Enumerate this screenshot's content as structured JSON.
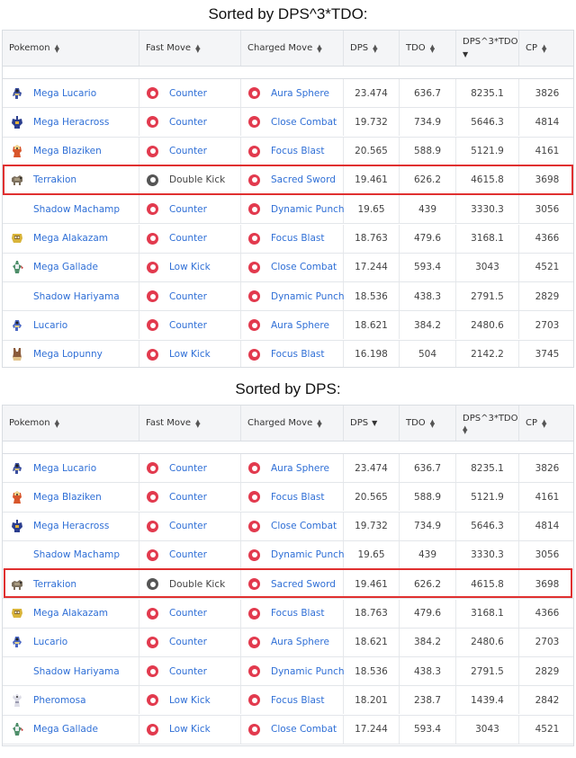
{
  "sections": [
    {
      "title": "Sorted by DPS^3*TDO:",
      "headers": {
        "pokemon": "Pokemon",
        "fast_move": "Fast Move",
        "charged_move": "Charged Move",
        "dps": "DPS",
        "tdo": "TDO",
        "dps3tdo": "DPS^3*TDO",
        "cp": "CP"
      },
      "rows": [
        {
          "pokemon": "Mega Lucario",
          "fast": "Counter",
          "charged": "Aura Sphere",
          "dps": "23.474",
          "tdo": "636.7",
          "dps3tdo": "8235.1",
          "cp": "3826"
        },
        {
          "pokemon": "Mega Heracross",
          "fast": "Counter",
          "charged": "Close Combat",
          "dps": "19.732",
          "tdo": "734.9",
          "dps3tdo": "5646.3",
          "cp": "4814"
        },
        {
          "pokemon": "Mega Blaziken",
          "fast": "Counter",
          "charged": "Focus Blast",
          "dps": "20.565",
          "tdo": "588.9",
          "dps3tdo": "5121.9",
          "cp": "4161"
        },
        {
          "pokemon": "Terrakion",
          "fast": "Double Kick",
          "charged": "Sacred Sword",
          "dps": "19.461",
          "tdo": "626.2",
          "dps3tdo": "4615.8",
          "cp": "3698"
        },
        {
          "pokemon": "Shadow Machamp",
          "fast": "Counter",
          "charged": "Dynamic Punch",
          "dps": "19.65",
          "tdo": "439",
          "dps3tdo": "3330.3",
          "cp": "3056"
        },
        {
          "pokemon": "Mega Alakazam",
          "fast": "Counter",
          "charged": "Focus Blast",
          "dps": "18.763",
          "tdo": "479.6",
          "dps3tdo": "3168.1",
          "cp": "4366"
        },
        {
          "pokemon": "Mega Gallade",
          "fast": "Low Kick",
          "charged": "Close Combat",
          "dps": "17.244",
          "tdo": "593.4",
          "dps3tdo": "3043",
          "cp": "4521"
        },
        {
          "pokemon": "Shadow Hariyama",
          "fast": "Counter",
          "charged": "Dynamic Punch",
          "dps": "18.536",
          "tdo": "438.3",
          "dps3tdo": "2791.5",
          "cp": "2829"
        },
        {
          "pokemon": "Lucario",
          "fast": "Counter",
          "charged": "Aura Sphere",
          "dps": "18.621",
          "tdo": "384.2",
          "dps3tdo": "2480.6",
          "cp": "2703"
        },
        {
          "pokemon": "Mega Lopunny",
          "fast": "Low Kick",
          "charged": "Focus Blast",
          "dps": "16.198",
          "tdo": "504",
          "dps3tdo": "2142.2",
          "cp": "3745"
        }
      ]
    },
    {
      "title": "Sorted by DPS:",
      "headers": {
        "pokemon": "Pokemon",
        "fast_move": "Fast Move",
        "charged_move": "Charged Move",
        "dps": "DPS",
        "tdo": "TDO",
        "dps3tdo": "DPS^3*TDO",
        "cp": "CP"
      },
      "rows": [
        {
          "pokemon": "Mega Lucario",
          "fast": "Counter",
          "charged": "Aura Sphere",
          "dps": "23.474",
          "tdo": "636.7",
          "dps3tdo": "8235.1",
          "cp": "3826"
        },
        {
          "pokemon": "Mega Blaziken",
          "fast": "Counter",
          "charged": "Focus Blast",
          "dps": "20.565",
          "tdo": "588.9",
          "dps3tdo": "5121.9",
          "cp": "4161"
        },
        {
          "pokemon": "Mega Heracross",
          "fast": "Counter",
          "charged": "Close Combat",
          "dps": "19.732",
          "tdo": "734.9",
          "dps3tdo": "5646.3",
          "cp": "4814"
        },
        {
          "pokemon": "Shadow Machamp",
          "fast": "Counter",
          "charged": "Dynamic Punch",
          "dps": "19.65",
          "tdo": "439",
          "dps3tdo": "3330.3",
          "cp": "3056"
        },
        {
          "pokemon": "Terrakion",
          "fast": "Double Kick",
          "charged": "Sacred Sword",
          "dps": "19.461",
          "tdo": "626.2",
          "dps3tdo": "4615.8",
          "cp": "3698"
        },
        {
          "pokemon": "Mega Alakazam",
          "fast": "Counter",
          "charged": "Focus Blast",
          "dps": "18.763",
          "tdo": "479.6",
          "dps3tdo": "3168.1",
          "cp": "4366"
        },
        {
          "pokemon": "Lucario",
          "fast": "Counter",
          "charged": "Aura Sphere",
          "dps": "18.621",
          "tdo": "384.2",
          "dps3tdo": "2480.6",
          "cp": "2703"
        },
        {
          "pokemon": "Shadow Hariyama",
          "fast": "Counter",
          "charged": "Dynamic Punch",
          "dps": "18.536",
          "tdo": "438.3",
          "dps3tdo": "2791.5",
          "cp": "2829"
        },
        {
          "pokemon": "Pheromosa",
          "fast": "Low Kick",
          "charged": "Focus Blast",
          "dps": "18.201",
          "tdo": "238.7",
          "dps3tdo": "1439.4",
          "cp": "2842"
        },
        {
          "pokemon": "Mega Gallade",
          "fast": "Low Kick",
          "charged": "Close Combat",
          "dps": "17.244",
          "tdo": "593.4",
          "dps3tdo": "3043",
          "cp": "4521"
        }
      ]
    }
  ],
  "colors": {
    "link": "#2f6fd6",
    "fighting_type": "#e23a4e",
    "normal_type": "#555555",
    "highlight": "#e03030"
  }
}
